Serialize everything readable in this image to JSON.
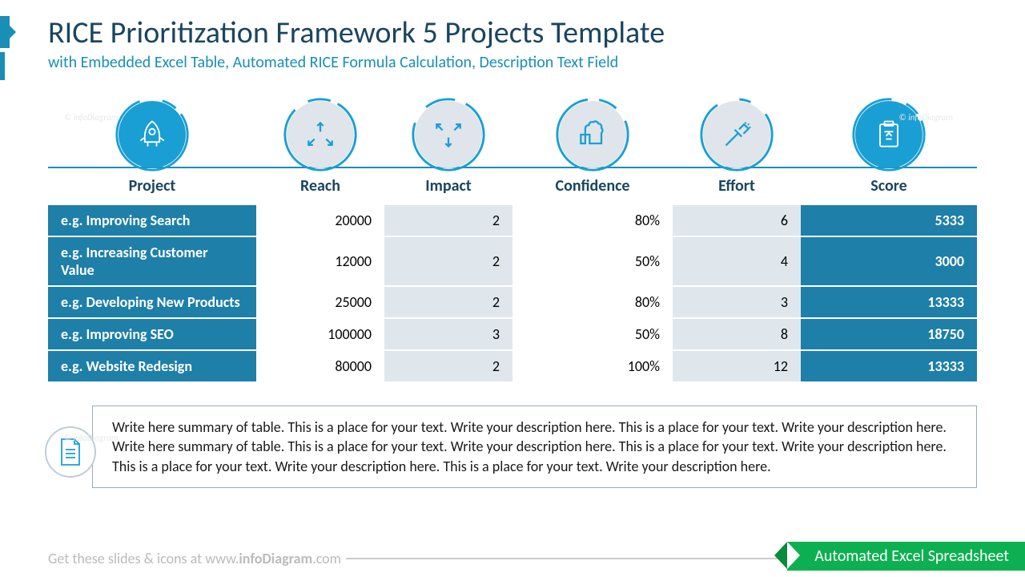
{
  "title": "RICE Prioritization Framework 5 Projects Template",
  "subtitle": "with Embedded Excel Table, Automated RICE Formula Calculation, Description Text Field",
  "columns": [
    "Project",
    "Reach",
    "Impact",
    "Confidence",
    "Effort",
    "Score"
  ],
  "rows": [
    {
      "project": "e.g. Improving Search",
      "reach": "20000",
      "impact": "2",
      "confidence": "80%",
      "effort": "6",
      "score": "5333"
    },
    {
      "project": "e.g. Increasing Customer Value",
      "reach": "12000",
      "impact": "2",
      "confidence": "50%",
      "effort": "4",
      "score": "3000"
    },
    {
      "project": "e.g. Developing New Products",
      "reach": "25000",
      "impact": "2",
      "confidence": "80%",
      "effort": "3",
      "score": "13333"
    },
    {
      "project": "e.g. Improving SEO",
      "reach": "100000",
      "impact": "3",
      "confidence": "50%",
      "effort": "8",
      "score": "18750"
    },
    {
      "project": "e.g. Website Redesign",
      "reach": "80000",
      "impact": "2",
      "confidence": "100%",
      "effort": "12",
      "score": "13333"
    }
  ],
  "description": "Write here summary of table. This is a place for your text. Write your description here. This is a place for your text. Write your description here. Write here summary of table. This is a place for your text. Write your description here. This is a place for your text. Write your description here. This is a place for your text. Write your description here. This is a place for your text. Write your description here.",
  "footer_prefix": "Get these slides & icons at www.",
  "footer_brand": "infoDiagram",
  "footer_suffix": ".com",
  "ribbon": "Automated Excel Spreadsheet",
  "watermark": "© infoDiagram"
}
